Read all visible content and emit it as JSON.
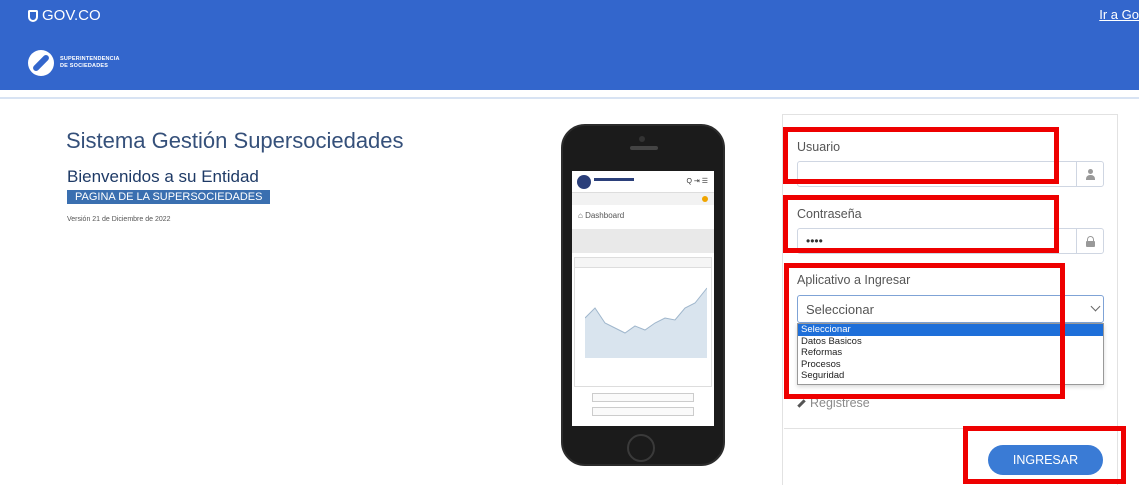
{
  "header": {
    "gov_logo": "GOV.CO",
    "ir_link": "Ir a Go",
    "brand_line1": "SUPERINTENDENCIA",
    "brand_line2": "DE SOCIEDADES",
    "color": "#3366cc"
  },
  "main": {
    "title": "Sistema Gestión Supersociedades",
    "welcome": "Bienvenidos a su Entidad",
    "supersoc_link": "PAGINA DE LA SUPERSOCIEDADES",
    "version": "Versión 21 de Diciembre de 2022"
  },
  "phone_preview": {
    "dashboard_title": "Dashboard",
    "icons": "Q ⇥ ☰"
  },
  "login": {
    "usuario_label": "Usuario",
    "usuario_value": "",
    "password_label": "Contraseña",
    "password_value": "••••",
    "app_label": "Aplicativo a Ingresar",
    "app_selected": "Seleccionar",
    "app_options": [
      "Seleccionar",
      "Datos Basicos",
      "Reformas",
      "Procesos",
      "Seguridad"
    ],
    "register_label": "Registrese",
    "submit_label": "INGRESAR",
    "accent_color": "#3a7bd5"
  },
  "annotation": {
    "highlight_color": "#ee0000"
  }
}
